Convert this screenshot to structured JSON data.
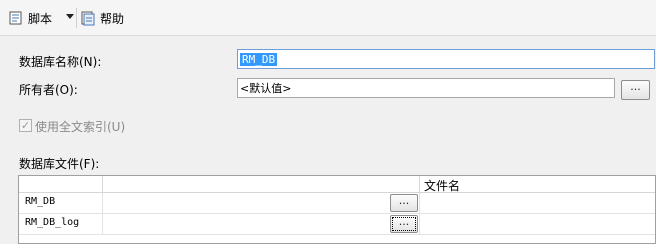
{
  "toolbar": {
    "script_label": "脚本",
    "help_label": "帮助",
    "script_icon": "script-icon",
    "help_icon": "help-icon"
  },
  "form": {
    "db_name_label": "数据库名称(N):",
    "db_name_value": "RM_DB",
    "owner_label": "所有者(O):",
    "owner_value": "<默认值>",
    "owner_browse": "...",
    "fulltext_label": "使用全文索引(U)",
    "fulltext_checked": true,
    "files_label": "数据库文件(F):"
  },
  "files_table": {
    "columns": [
      "",
      "",
      "文件名"
    ],
    "rows": [
      {
        "name": "RM_DB",
        "browse": "...",
        "file_name": ""
      },
      {
        "name": "RM_DB_log",
        "browse": "...",
        "file_name": ""
      }
    ]
  }
}
